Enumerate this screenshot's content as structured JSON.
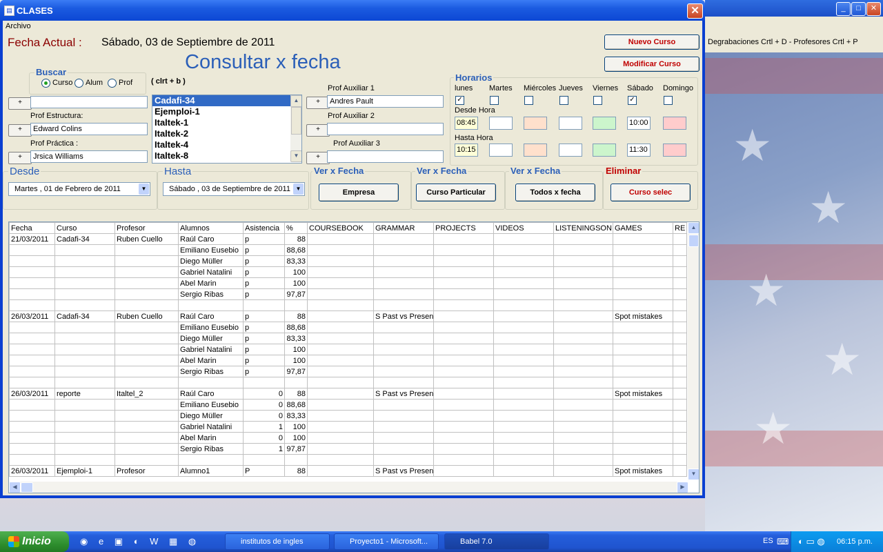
{
  "window": {
    "title": "CLASES",
    "menu": [
      "Archivo"
    ]
  },
  "header": {
    "fecha_label": "Fecha  Actual :",
    "fecha_value": "Sábado, 03 de Septiembre de 2011",
    "heading": "Consultar  x fecha"
  },
  "buttons": {
    "nuevo": "Nuevo Curso",
    "modificar": "Modificar Curso",
    "empresa": "Empresa",
    "particular": "Curso Particular",
    "todos": "Todos x fecha",
    "curso_selec": "Curso selec"
  },
  "buscar": {
    "label": "Buscar",
    "options": [
      "Curso",
      "Alum",
      "Prof"
    ],
    "shortcut": "( clrt + b )"
  },
  "profs": {
    "estructura_label": "Prof Estructura:",
    "estructura_value": "Edward Colins",
    "practica_label": "Prof Práctica :",
    "practica_value": "Jrsica Williams",
    "aux1_label": "Prof Auxiliar 1",
    "aux1_value": "Andres Pault",
    "aux2_label": "Prof Auxiliar 2",
    "aux3_label": "Prof Auxiliar 3",
    "plus": "+"
  },
  "cursos": [
    "Cadafi-34",
    "Ejemploi-1",
    "Italtek-1",
    "Italtek-2",
    "Italtek-4",
    "Italtek-8"
  ],
  "horarios": {
    "label": "Horarios",
    "days": [
      "lunes",
      "Martes",
      "Miércoles",
      "Jueves",
      "Viernes",
      "Sábado",
      "Domingo"
    ],
    "checked": [
      "✓",
      "",
      "",
      "",
      "",
      "✓",
      ""
    ],
    "desde_label": "Desde Hora",
    "hasta_label": "Hasta Hora",
    "desde": [
      "08:45",
      "",
      "",
      "",
      "",
      "10:00",
      ""
    ],
    "hasta": [
      "10:15",
      "",
      "",
      "",
      "",
      "11:30",
      ""
    ]
  },
  "filters": {
    "desde_label": "Desde",
    "desde_value": "Martes   , 01 de    Febrero    de 2011",
    "hasta_label": "Hasta",
    "hasta_value": "Sábado , 03 de Septiembre de 2011",
    "ver1": "Ver x Fecha",
    "ver2": "Ver x Fecha",
    "ver3": "Ver x Fecha",
    "eliminar": "Eliminar"
  },
  "table": {
    "columns": [
      "Fecha",
      "Curso",
      "Profesor",
      "Alumnos",
      "Asistencia",
      "%",
      "COURSEBOOK",
      "GRAMMAR",
      "PROJECTS",
      "VIDEOS",
      "LISTENINGSON",
      "GAMES",
      "RE"
    ],
    "rows": [
      [
        "21/03/2011",
        "Cadafi-34",
        "Ruben Cuello",
        "Raúl Caro",
        "p",
        "88",
        "",
        "",
        "",
        "",
        "",
        "",
        ""
      ],
      [
        "",
        "",
        "",
        "Emiliano Eusebio",
        "p",
        "88,68",
        "",
        "",
        "",
        "",
        "",
        "",
        ""
      ],
      [
        "",
        "",
        "",
        "Diego Müller",
        "p",
        "83,33",
        "",
        "",
        "",
        "",
        "",
        "",
        ""
      ],
      [
        "",
        "",
        "",
        "Gabriel Natalini",
        "p",
        "100",
        "",
        "",
        "",
        "",
        "",
        "",
        ""
      ],
      [
        "",
        "",
        "",
        "Abel Marin",
        "p",
        "100",
        "",
        "",
        "",
        "",
        "",
        "",
        ""
      ],
      [
        "",
        "",
        "",
        "Sergio Ribas",
        "p",
        "97,87",
        "",
        "",
        "",
        "",
        "",
        "",
        ""
      ],
      [
        "",
        "",
        "",
        "",
        "",
        "",
        "",
        "",
        "",
        "",
        "",
        "",
        ""
      ],
      [
        "26/03/2011",
        "Cadafi-34",
        "Ruben Cuello",
        "Raúl Caro",
        "p",
        "88",
        "",
        "S Past vs Presen",
        "",
        "",
        "",
        "Spot mistakes",
        ""
      ],
      [
        "",
        "",
        "",
        "Emiliano Eusebio",
        "p",
        "88,68",
        "",
        "",
        "",
        "",
        "",
        "",
        ""
      ],
      [
        "",
        "",
        "",
        "Diego Müller",
        "p",
        "83,33",
        "",
        "",
        "",
        "",
        "",
        "",
        ""
      ],
      [
        "",
        "",
        "",
        "Gabriel Natalini",
        "p",
        "100",
        "",
        "",
        "",
        "",
        "",
        "",
        ""
      ],
      [
        "",
        "",
        "",
        "Abel Marin",
        "p",
        "100",
        "",
        "",
        "",
        "",
        "",
        "",
        ""
      ],
      [
        "",
        "",
        "",
        "Sergio Ribas",
        "p",
        "97,87",
        "",
        "",
        "",
        "",
        "",
        "",
        ""
      ],
      [
        "",
        "",
        "",
        "",
        "",
        "",
        "",
        "",
        "",
        "",
        "",
        "",
        ""
      ],
      [
        "26/03/2011",
        "reporte",
        "Italtel_2",
        "Raúl Caro",
        "0",
        "88",
        "",
        "S Past vs Presen",
        "",
        "",
        "",
        "Spot mistakes",
        ""
      ],
      [
        "",
        "",
        "",
        "Emiliano Eusebio",
        "0",
        "88,68",
        "",
        "",
        "",
        "",
        "",
        "",
        ""
      ],
      [
        "",
        "",
        "",
        "Diego Müller",
        "0",
        "83,33",
        "",
        "",
        "",
        "",
        "",
        "",
        ""
      ],
      [
        "",
        "",
        "",
        "Gabriel Natalini",
        "1",
        "100",
        "",
        "",
        "",
        "",
        "",
        "",
        ""
      ],
      [
        "",
        "",
        "",
        "Abel Marin",
        "0",
        "100",
        "",
        "",
        "",
        "",
        "",
        "",
        ""
      ],
      [
        "",
        "",
        "",
        "Sergio Ribas",
        "1",
        "97,87",
        "",
        "",
        "",
        "",
        "",
        "",
        ""
      ],
      [
        "",
        "",
        "",
        "",
        "",
        "",
        "",
        "",
        "",
        "",
        "",
        "",
        ""
      ],
      [
        "26/03/2011",
        "Ejemploi-1",
        "Profesor",
        "Alumno1",
        "P",
        "88",
        "",
        "S Past vs Presen",
        "",
        "",
        "",
        "Spot mistakes",
        ""
      ]
    ]
  },
  "background_window": {
    "shortcuts": "Degrabaciones  Crtl + D     -     Profesores Crtl + P"
  },
  "taskbar": {
    "start": "Inicio",
    "items": [
      "institutos de ingles",
      "Proyecto1 - Microsoft...",
      "Babel 7.0"
    ],
    "lang": "ES",
    "time": "06:15 p.m."
  }
}
